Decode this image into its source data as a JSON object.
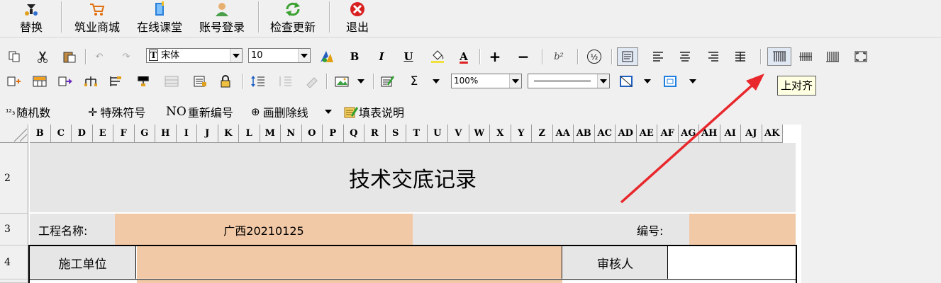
{
  "top_toolbar": {
    "buttons": [
      {
        "label": "替换",
        "icon": "replace-icon"
      },
      {
        "label": "筑业商城",
        "icon": "cart-icon"
      },
      {
        "label": "在线课堂",
        "icon": "book-icon"
      },
      {
        "label": "账号登录",
        "icon": "user-icon"
      },
      {
        "label": "检查更新",
        "icon": "refresh-icon"
      },
      {
        "label": "退出",
        "icon": "exit-icon"
      }
    ]
  },
  "format_bar": {
    "font_name": "宋体",
    "font_size": "10",
    "superscript": "b²",
    "bold": "B",
    "italic": "I",
    "underline": "U",
    "color_a": "A",
    "plus": "+",
    "minus": "−",
    "fraction": "½"
  },
  "format_bar2": {
    "sigma": "Σ",
    "zoom": "100%"
  },
  "misc_bar": {
    "random_number": "随机数",
    "random_prefix": "¹²₃",
    "special_symbol": "特殊符号",
    "renumber": "重新编号",
    "renumber_prefix": "NO",
    "strikethrough": "画删除线",
    "fill_help": "填表说明"
  },
  "tooltip": {
    "text": "上对齐"
  },
  "sheet": {
    "columns": [
      "B",
      "C",
      "D",
      "E",
      "F",
      "G",
      "H",
      "I",
      "J",
      "K",
      "L",
      "M",
      "N",
      "O",
      "P",
      "Q",
      "R",
      "S",
      "T",
      "U",
      "V",
      "W",
      "X",
      "Y",
      "Z",
      "AA",
      "AB",
      "AC",
      "AD",
      "AE",
      "AF",
      "AG",
      "AH",
      "AI",
      "AJ",
      "AK"
    ],
    "rows": [
      "2",
      "3",
      "4"
    ],
    "title": "技术交底记录",
    "project_name_label": "工程名称:",
    "project_name_value": "广西20210125",
    "number_label": "编号:",
    "construction_unit_label": "施工单位",
    "reviewer_label": "审核人"
  },
  "colors": {
    "fill_cell": "#f2c9a6",
    "arrow": "#e8282c"
  }
}
